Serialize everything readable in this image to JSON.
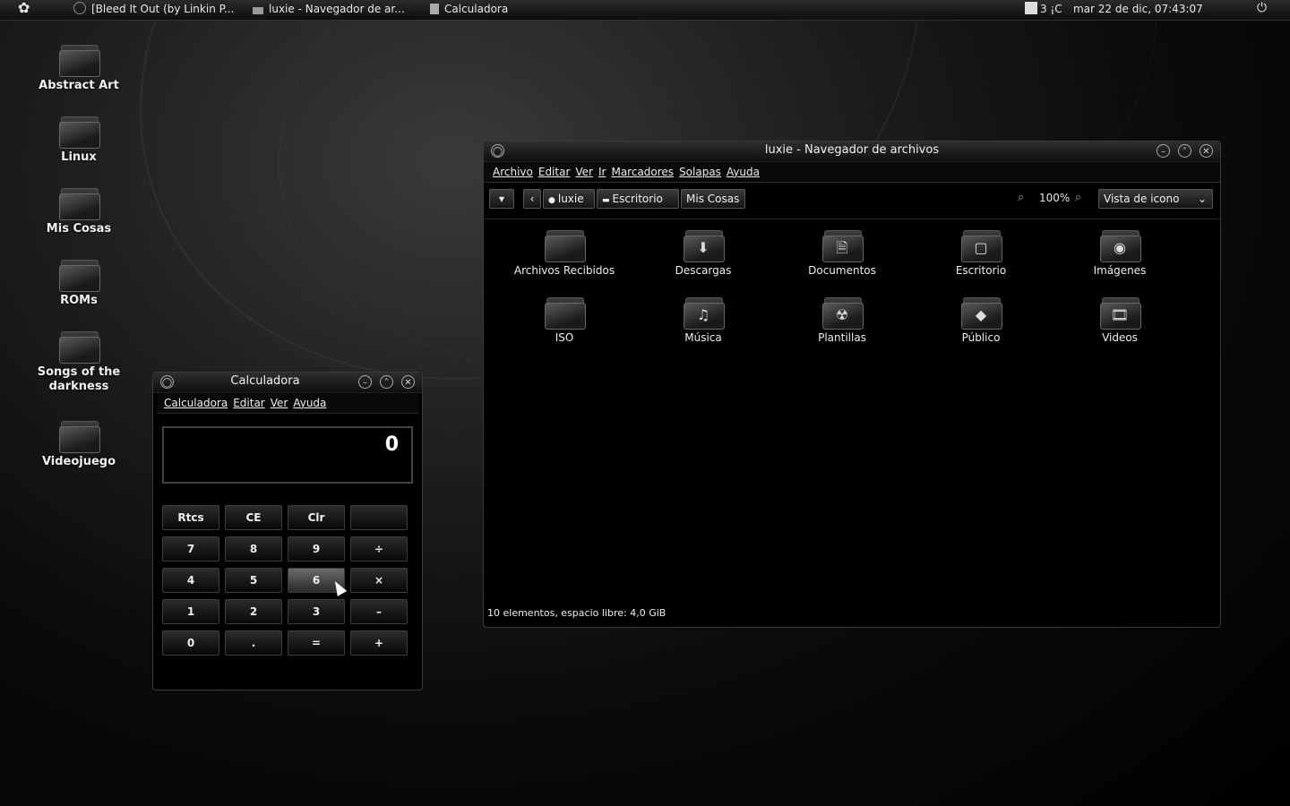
{
  "top_panel": {
    "tasks": [
      {
        "label": "[Bleed It Out (by Linkin P..."
      },
      {
        "label": "luxie - Navegador de ar..."
      },
      {
        "label": "Calculadora"
      }
    ],
    "weather": "3 ¡C",
    "clock": "mar 22 de dic, 07:43:07"
  },
  "desktop_icons": [
    {
      "label": "Abstract Art"
    },
    {
      "label": "Linux"
    },
    {
      "label": "Mis Cosas"
    },
    {
      "label": "ROMs"
    },
    {
      "label": "Songs of the darkness"
    },
    {
      "label": "Videojuego"
    }
  ],
  "file_browser": {
    "title": "luxie - Navegador de archivos",
    "menu": [
      "Archivo",
      "Editar",
      "Ver",
      "Ir",
      "Marcadores",
      "Solapas",
      "Ayuda"
    ],
    "path": [
      "luxie",
      "Escritorio",
      "Mis Cosas"
    ],
    "zoom": "100%",
    "view_mode": "Vista de icono",
    "items": [
      {
        "label": "Archivos Recibidos",
        "icon": "folder-icon"
      },
      {
        "label": "Descargas",
        "icon": "download-folder-icon"
      },
      {
        "label": "Documentos",
        "icon": "documents-folder-icon"
      },
      {
        "label": "Escritorio",
        "icon": "desktop-folder-icon"
      },
      {
        "label": "Imágenes",
        "icon": "pictures-folder-icon"
      },
      {
        "label": "ISO",
        "icon": "folder-icon"
      },
      {
        "label": "Música",
        "icon": "music-folder-icon"
      },
      {
        "label": "Plantillas",
        "icon": "templates-folder-icon"
      },
      {
        "label": "Público",
        "icon": "public-folder-icon"
      },
      {
        "label": "Videos",
        "icon": "videos-folder-icon"
      }
    ],
    "status": "10 elementos, espacio libre: 4,0 GiB"
  },
  "calculator": {
    "title": "Calculadora",
    "menu": [
      "Calculadora",
      "Editar",
      "Ver",
      "Ayuda"
    ],
    "display": "0",
    "buttons": [
      [
        "Rtcs",
        "CE",
        "Clr",
        ""
      ],
      [
        "7",
        "8",
        "9",
        "÷"
      ],
      [
        "4",
        "5",
        "6",
        "×"
      ],
      [
        "1",
        "2",
        "3",
        "–"
      ],
      [
        "0",
        ".",
        "=",
        "+"
      ]
    ]
  }
}
